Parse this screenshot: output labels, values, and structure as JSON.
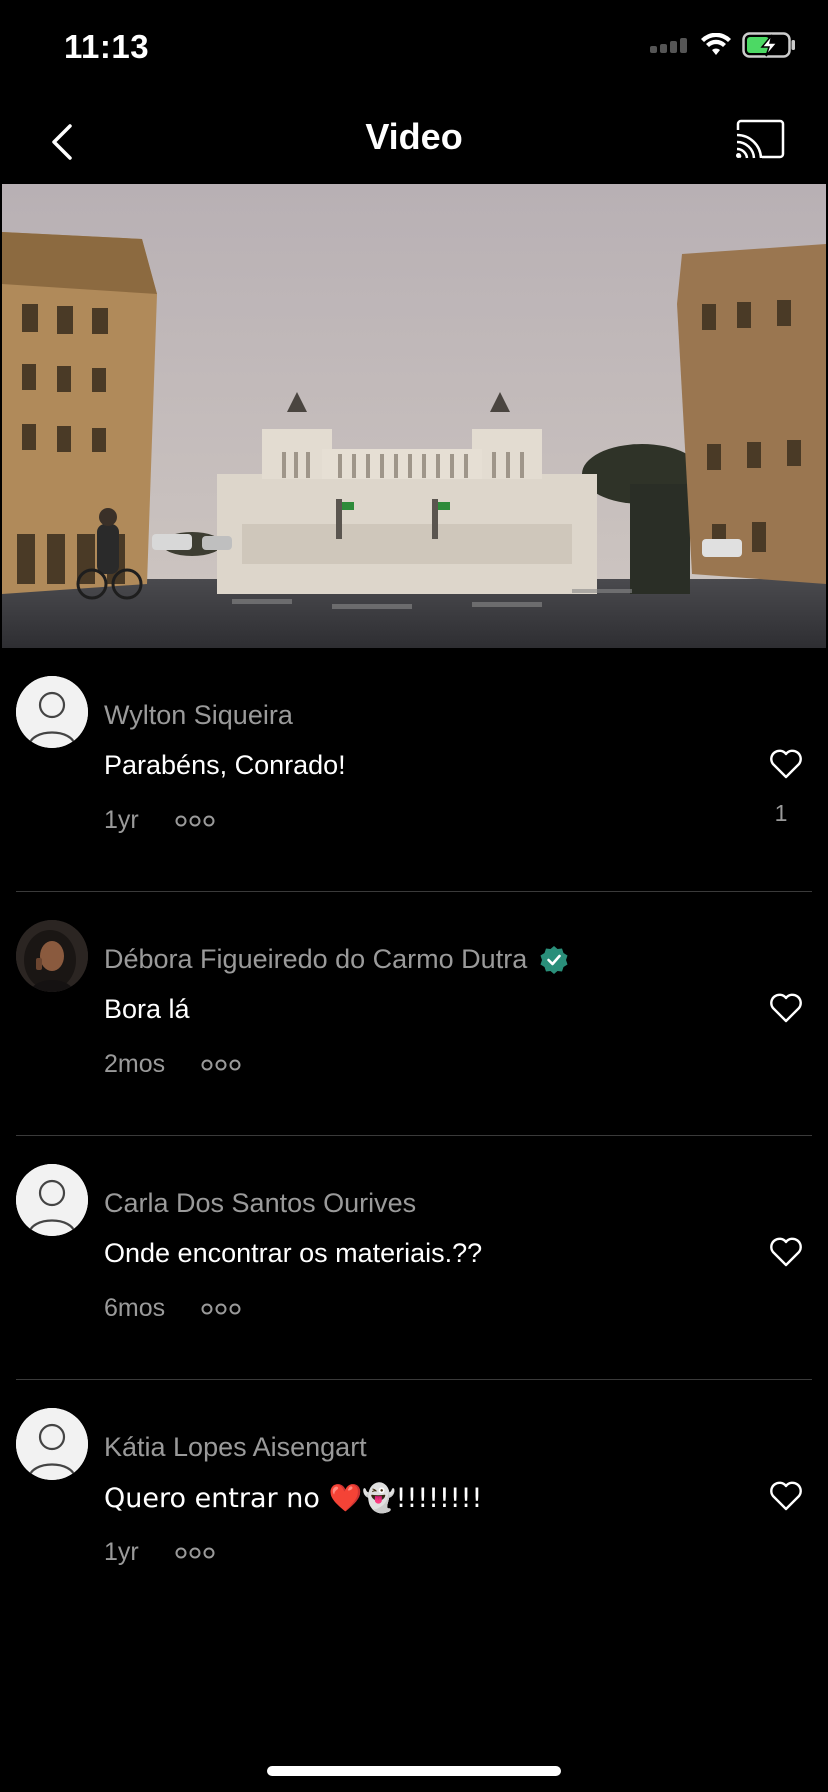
{
  "status_bar": {
    "time": "11:13",
    "icons": [
      "signal-icon",
      "wifi-icon",
      "battery-charging-icon"
    ],
    "battery_color": "#4cd964"
  },
  "nav": {
    "title": "Video",
    "back_icon": "chevron-left-icon",
    "cast_icon": "cast-icon"
  },
  "video": {
    "description_icon": "video-thumbnail"
  },
  "colors": {
    "background": "#000000",
    "secondary_text": "#9a9a9a",
    "divider": "#3a3a3a",
    "verified": "#2a8f7a"
  },
  "comments": [
    {
      "author": "Wylton Siqueira",
      "text": "Parabéns, Conrado!",
      "age": "1yr",
      "likes": "1",
      "avatar": "default-avatar-icon",
      "verified": false
    },
    {
      "author": "Débora Figueiredo do Carmo Dutra",
      "text": "Bora lá",
      "age": "2mos",
      "likes": "",
      "avatar": "photo-avatar",
      "verified": true
    },
    {
      "author": "Carla Dos Santos Ourives",
      "text": "Onde encontrar os materiais.??",
      "age": "6mos",
      "likes": "",
      "avatar": "default-avatar-icon",
      "verified": false
    },
    {
      "author": "Kátia Lopes Aisengart",
      "text": "Quero entrar no ❤️👻!!!!!!!!",
      "age": "1yr",
      "likes": "",
      "avatar": "default-avatar-icon",
      "verified": false
    }
  ]
}
